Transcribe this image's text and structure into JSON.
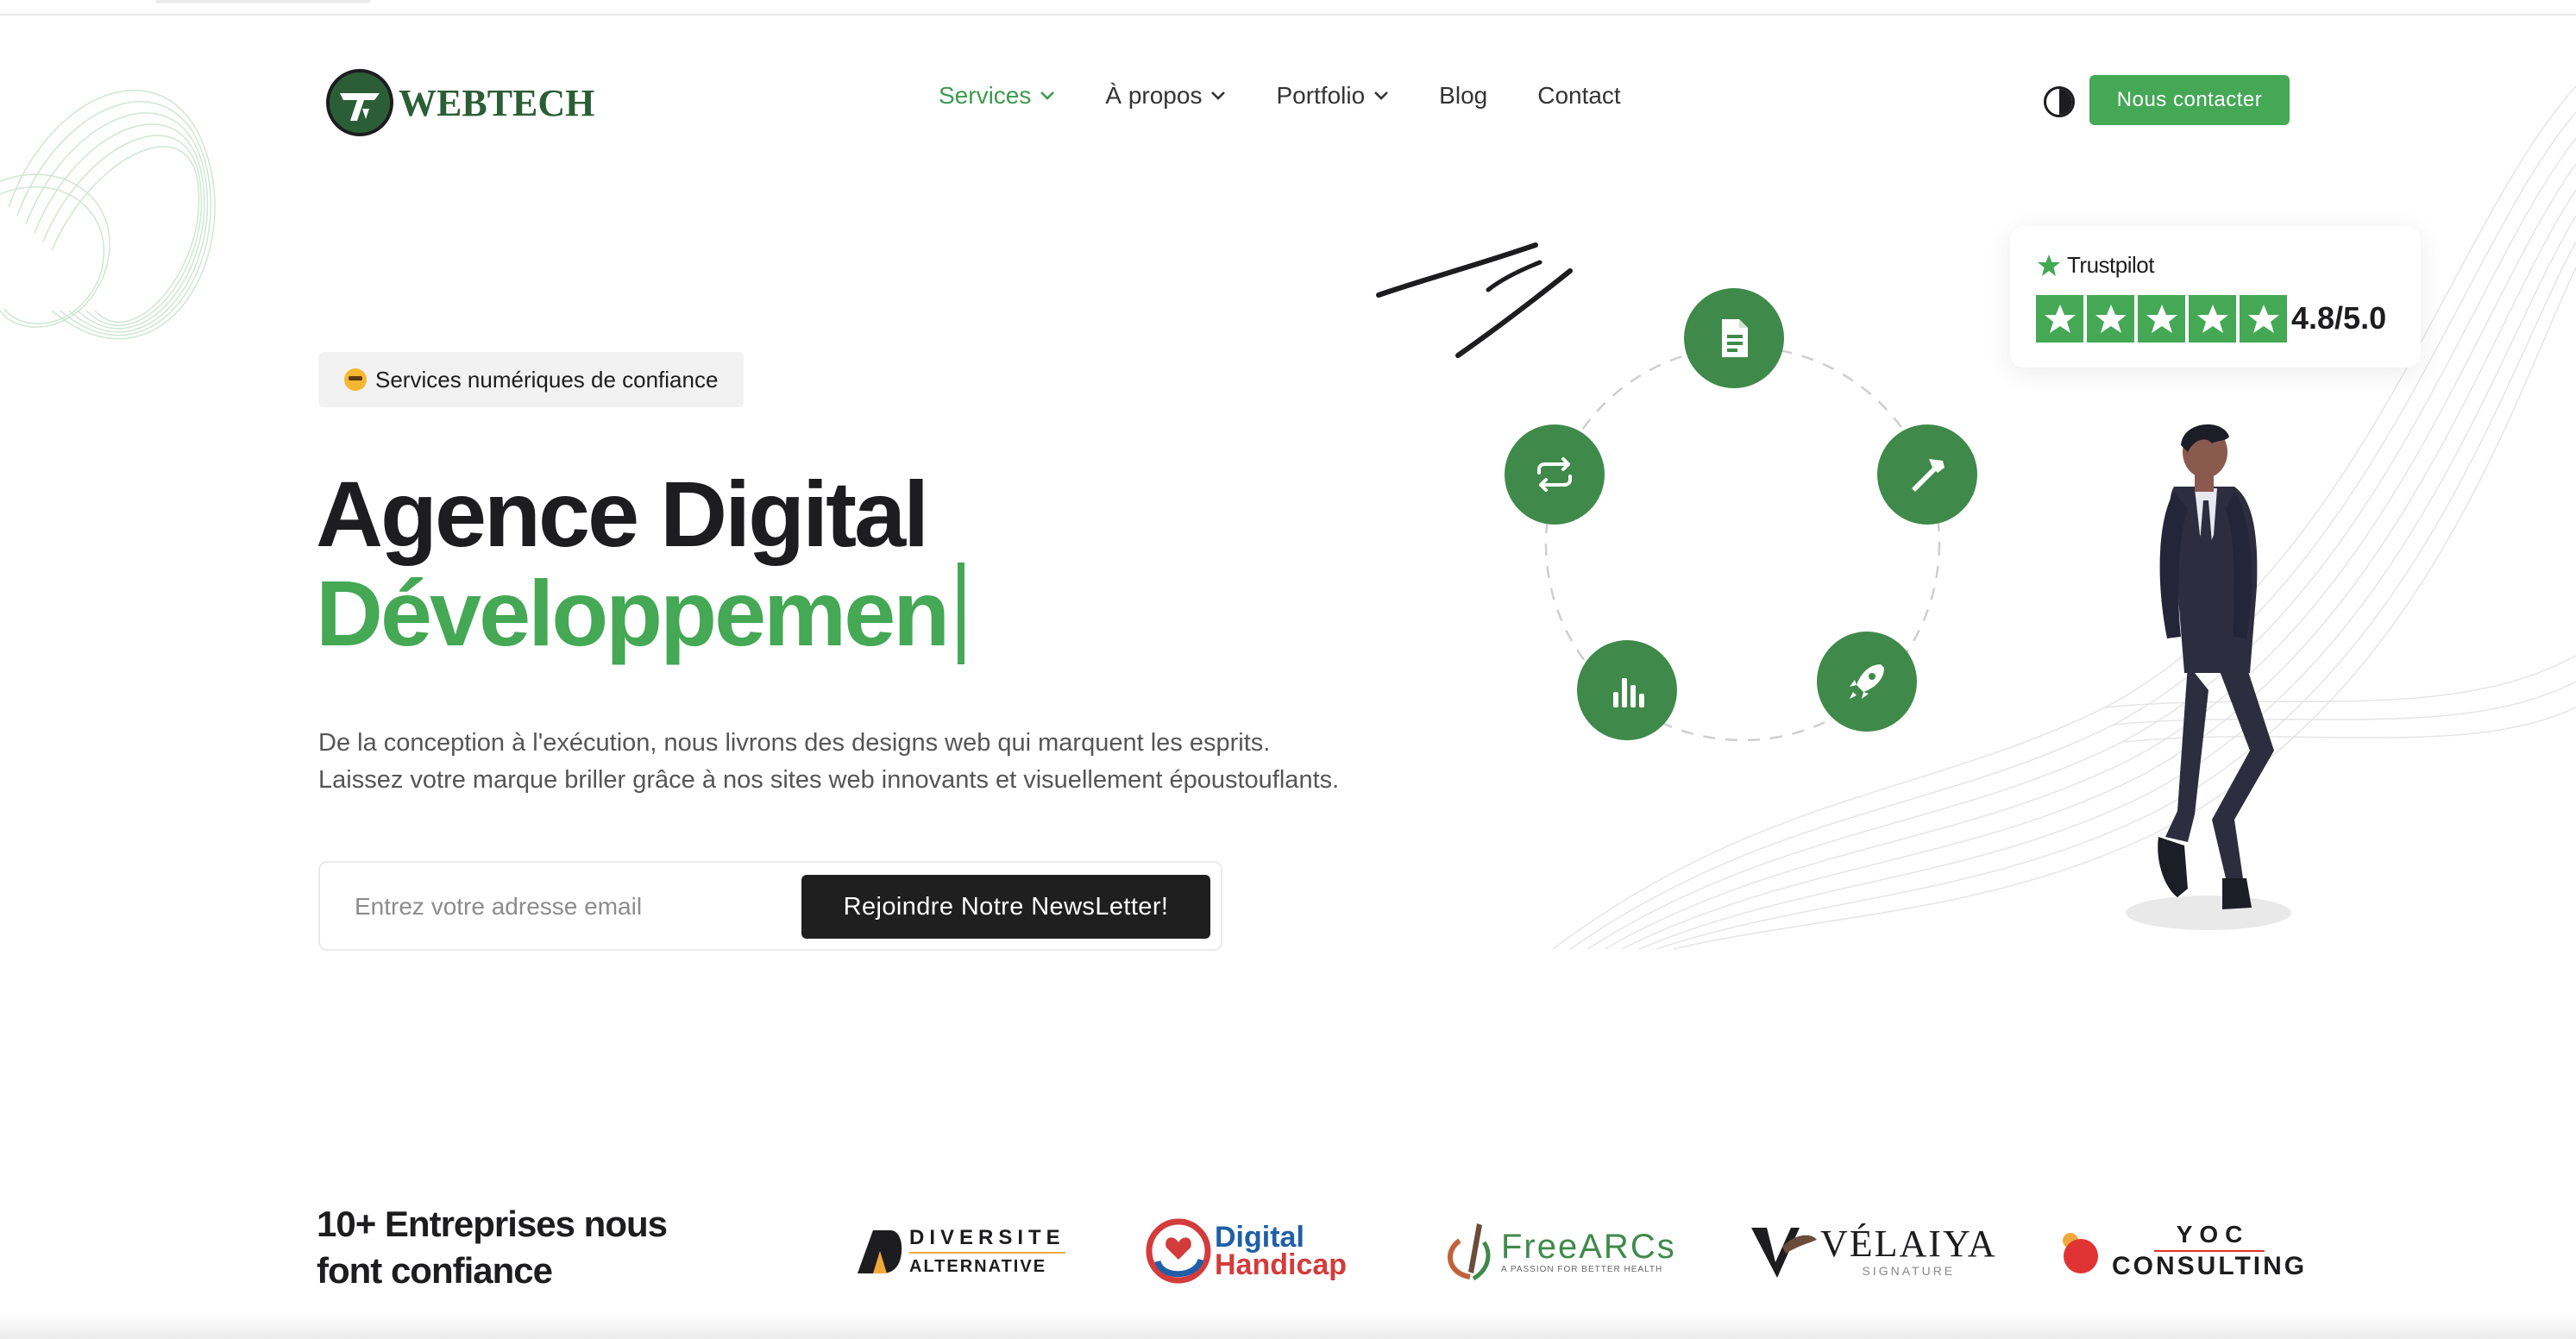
{
  "brand": {
    "name": "WEBTECH",
    "color": "#2b5e36",
    "accent": "#44a855"
  },
  "nav": {
    "items": [
      {
        "label": "Services",
        "has_dropdown": true,
        "active": true
      },
      {
        "label": "À propos",
        "has_dropdown": true,
        "active": false
      },
      {
        "label": "Portfolio",
        "has_dropdown": true,
        "active": false
      },
      {
        "label": "Blog",
        "has_dropdown": false,
        "active": false
      },
      {
        "label": "Contact",
        "has_dropdown": false,
        "active": false
      }
    ],
    "theme_toggle_icon": "contrast-icon",
    "cta_label": "Nous contacter"
  },
  "hero": {
    "badge_emoji": "star-struck-emoji",
    "badge_text": "Services numériques de confiance",
    "title": "Agence Digital",
    "typed_word": "Développemen",
    "description_line1": "De la conception à l'exécution, nous livrons des designs web qui marquent les esprits.",
    "description_line2": "Laissez votre marque briller grâce à nos sites web innovants et visuellement époustouflants.",
    "newsletter": {
      "placeholder": "Entrez votre adresse email",
      "value": "",
      "button_label": "Rejoindre Notre NewsLetter!"
    }
  },
  "illustration": {
    "icons": [
      "document-icon",
      "hammer-icon",
      "rocket-icon",
      "bar-chart-icon",
      "repeat-icon"
    ],
    "trustpilot": {
      "brand": "Trustpilot",
      "stars": 5,
      "rating": "4.8/5.0"
    }
  },
  "trusted": {
    "title_line1": "10+ Entreprises nous",
    "title_line2": "font confiance",
    "partners": [
      {
        "name_line1": "DIVERSITE",
        "name_line2": "ALTERNATIVE"
      },
      {
        "name_line1": "Digital",
        "name_line2": "Handicap"
      },
      {
        "name_line1": "FreeARCs",
        "name_line2": "A PASSION FOR BETTER HEALTH"
      },
      {
        "name_line1": "VÉLAIYA",
        "name_line2": "SIGNATURE"
      },
      {
        "name_line1": "YOC",
        "name_line2": "CONSULTING"
      }
    ]
  }
}
